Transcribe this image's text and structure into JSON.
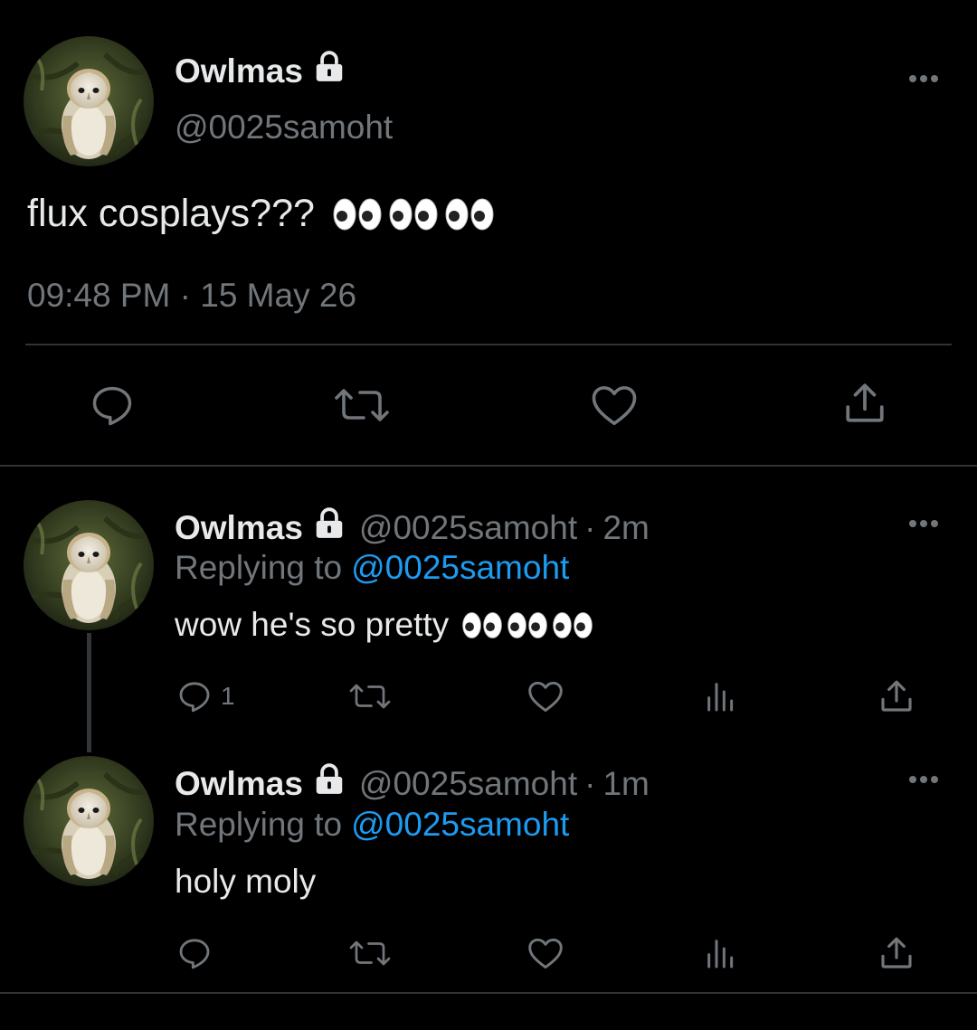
{
  "main_tweet": {
    "display_name": "Owlmas",
    "handle": "@0025samoht",
    "text": "flux cosplays???",
    "emoji": "eyes-emoji",
    "timestamp": "09:48 PM · 15 May 26"
  },
  "replies": [
    {
      "display_name": "Owlmas",
      "handle": "@0025samoht",
      "separator": "·",
      "time": "2m",
      "replying_prefix": "Replying to",
      "replying_to": "@0025samoht",
      "text": "wow he's so pretty",
      "reply_count": "1"
    },
    {
      "display_name": "Owlmas",
      "handle": "@0025samoht",
      "separator": "·",
      "time": "1m",
      "replying_prefix": "Replying to",
      "replying_to": "@0025samoht",
      "text": "holy moly"
    }
  ],
  "icons": {
    "reply": "reply-icon",
    "retweet": "retweet-icon",
    "like": "like-icon",
    "share": "share-icon",
    "views": "views-icon",
    "more": "more-icon",
    "lock": "lock-icon"
  },
  "colors": {
    "background": "#000000",
    "primary_text": "#e7e9ea",
    "secondary_text": "#71767b",
    "link": "#1d9bf0",
    "divider": "#2f3336"
  }
}
